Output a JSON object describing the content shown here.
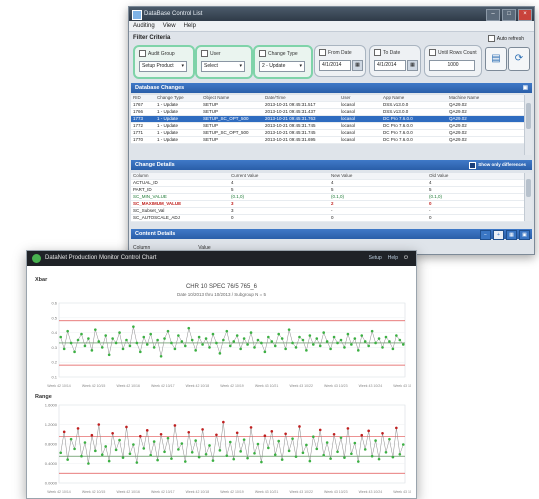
{
  "main_window": {
    "title": "DataBase Control List",
    "menu": [
      "Auditing",
      "View",
      "Help"
    ],
    "filter_criteria_label": "Filter Criteria",
    "auto_refresh_label": "Auto refresh",
    "filters": [
      {
        "label": "Audit Group",
        "value": "Setup Product"
      },
      {
        "label": "User",
        "value": "Select"
      },
      {
        "label": "Change Type",
        "value": "2 - Update"
      },
      {
        "label": "From Date",
        "value": "4/1/2014"
      },
      {
        "label": "To Date",
        "value": "4/1/2014"
      },
      {
        "label": "Until Rows Count",
        "value": "1000"
      }
    ],
    "database_changes": {
      "title": "Database Changes",
      "columns": [
        "RID",
        "Change Type",
        "Object Name",
        "Date/Time",
        "User",
        "App Name",
        "Machine Name"
      ],
      "rows": [
        [
          "1767",
          "1 - Update",
          "SETUP",
          "2013-10-21 09:45:31.517",
          "locasol",
          "DSS.v13.0.0",
          "QA29.02"
        ],
        [
          "1766",
          "1 - Update",
          "SETUP",
          "2013-10-21 09:45:31.437",
          "locasol",
          "DSS.v13.0.0",
          "QA29.02"
        ],
        [
          "1773",
          "1 - Update",
          "SETUP_SC_OPT_500",
          "2013-10-21 09:45:31.763",
          "locasol",
          "DC Pro 7.6.0.0",
          "QA29.02"
        ],
        [
          "1772",
          "1 - Update",
          "SETUP",
          "2013-10-21 09:45:31.745",
          "locasol",
          "DC Pro 7.6.0.0",
          "QA29.02"
        ],
        [
          "1771",
          "1 - Update",
          "SETUP_SC_OPT_500",
          "2013-10-21 09:45:31.745",
          "locasol",
          "DC Pro 7.6.0.0",
          "QA29.02"
        ],
        [
          "1770",
          "1 - Update",
          "SETUP",
          "2013-10-21 09:45:31.695",
          "locasol",
          "DC Pro 7.6.0.0",
          "QA29.02"
        ]
      ],
      "selected_index": 2
    },
    "change_details": {
      "title": "Change Details",
      "show_only_differences_label": "Show only differences",
      "columns": [
        "Column",
        "Current Value",
        "New Value",
        "Old Value"
      ],
      "rows": [
        {
          "cells": [
            "ACTUAL_ID",
            "4",
            "4",
            "4"
          ],
          "state": "normal"
        },
        {
          "cells": [
            "PART_ID",
            "5",
            "5",
            "5"
          ],
          "state": "normal"
        },
        {
          "cells": [
            "SC_MIN_VALUE",
            "(0.1,0)",
            "(0.1,0)",
            "(0.1,0)"
          ],
          "state": "green"
        },
        {
          "cells": [
            "SC_MAXIMUM_VALUE",
            "3",
            "2",
            "0"
          ],
          "state": "red"
        },
        {
          "cells": [
            "SC_Subset_Val",
            "3",
            "-",
            "-"
          ],
          "state": "normal"
        },
        {
          "cells": [
            "SC_AUTOSCALE_ADJ",
            "0",
            "0",
            "0"
          ],
          "state": "normal"
        }
      ]
    },
    "content_details": {
      "title": "Content Details",
      "columns": [
        "Column",
        "Value"
      ]
    }
  },
  "chart_window": {
    "title": "DataNet Production Monitor Control Chart",
    "header_links": [
      "Setup",
      "Help"
    ],
    "colors": {
      "green_point": "#3cb043",
      "red_point": "#c02020",
      "limit": "#e05050",
      "center": "#3a7d3a",
      "line": "#8a8a8a"
    }
  },
  "chart_data": [
    {
      "type": "line",
      "section_label": "Xbar",
      "title": "CHR 10 SPEC 76/5 765_6",
      "subtitle": "Date 10/2013 thru 10/2013 / Subgroup N = 5",
      "ylim": [
        0.1,
        0.6
      ],
      "y_ticks": [
        "0.6",
        "0.5",
        "0.4",
        "0.3",
        "0.2",
        "0.1"
      ],
      "x_ticks": [
        "Week 42 10/14",
        "Week 42 10/15",
        "Week 42 10/16",
        "Week 42 10/17",
        "Week 42 10/18",
        "Week 42 10/19",
        "Week 43 10/21",
        "Week 43 10/22",
        "Week 43 10/23",
        "Week 43 10/24",
        "Week 43 10/25"
      ],
      "ucl": 0.48,
      "center": 0.33,
      "lcl": 0.18,
      "series": [
        {
          "values": [
            0.37,
            0.29,
            0.41,
            0.33,
            0.27,
            0.35,
            0.39,
            0.31,
            0.36,
            0.28,
            0.42,
            0.34,
            0.3,
            0.38,
            0.25,
            0.36,
            0.33,
            0.4,
            0.29,
            0.35,
            0.31,
            0.44,
            0.33,
            0.27,
            0.37,
            0.32,
            0.39,
            0.3,
            0.35,
            0.24,
            0.36,
            0.41,
            0.33,
            0.29,
            0.38,
            0.34,
            0.31,
            0.43,
            0.35,
            0.28,
            0.37,
            0.32,
            0.36,
            0.3,
            0.39,
            0.33,
            0.26,
            0.35,
            0.41,
            0.31,
            0.34,
            0.38,
            0.29,
            0.36,
            0.32,
            0.4,
            0.3,
            0.35,
            0.33,
            0.27,
            0.37,
            0.34,
            0.31,
            0.39,
            0.36,
            0.29,
            0.42,
            0.33,
            0.3,
            0.37,
            0.35,
            0.28,
            0.38,
            0.32,
            0.36,
            0.31,
            0.4,
            0.34,
            0.29,
            0.37,
            0.33,
            0.35,
            0.3,
            0.39,
            0.32,
            0.36,
            0.28,
            0.38,
            0.34,
            0.31,
            0.41,
            0.33,
            0.36,
            0.3,
            0.37,
            0.34,
            0.29,
            0.38,
            0.35,
            0.32
          ]
        }
      ]
    },
    {
      "type": "line",
      "section_label": "Range",
      "title": "",
      "ylim": [
        0,
        1.6
      ],
      "y_ticks": [
        "1.6000",
        "1.2000",
        "0.8000",
        "0.4000",
        "0.0000"
      ],
      "x_ticks": [
        "Week 42 10/14",
        "Week 42 10/15",
        "Week 42 10/16",
        "Week 42 10/17",
        "Week 42 10/18",
        "Week 42 10/19",
        "Week 43 10/21",
        "Week 43 10/22",
        "Week 43 10/23",
        "Week 43 10/24",
        "Week 43 10/25"
      ],
      "ucl": 0.95,
      "center": 0.55,
      "lcl": 0.2,
      "series": [
        {
          "values": [
            0.62,
            1.05,
            0.48,
            0.9,
            0.7,
            1.12,
            0.55,
            0.83,
            0.4,
            0.98,
            0.66,
            1.2,
            0.58,
            0.75,
            0.45,
            1.02,
            0.68,
            0.88,
            0.52,
            1.15,
            0.6,
            0.79,
            0.42,
            0.96,
            0.71,
            1.08,
            0.57,
            0.85,
            0.47,
            1.0,
            0.64,
            0.92,
            0.5,
            1.18,
            0.69,
            0.81,
            0.44,
            1.04,
            0.63,
            0.87,
            0.53,
            1.1,
            0.59,
            0.77,
            0.46,
            0.99,
            0.67,
            1.25,
            0.56,
            0.84,
            0.49,
            1.03,
            0.65,
            0.89,
            0.51,
            1.14,
            0.61,
            0.8,
            0.43,
            0.97,
            0.72,
            1.06,
            0.58,
            0.86,
            0.48,
            1.01,
            0.66,
            0.91,
            0.54,
            1.16,
            0.62,
            0.78,
            0.45,
            0.95,
            0.7,
            1.09,
            0.57,
            0.83,
            0.5,
            1.0,
            0.64,
            0.93,
            0.52,
            1.12,
            0.6,
            0.82,
            0.44,
            0.98,
            0.69,
            1.07,
            0.55,
            0.87,
            0.49,
            1.02,
            0.63,
            0.9,
            0.53,
            1.13,
            0.59,
            0.79
          ]
        }
      ]
    }
  ]
}
